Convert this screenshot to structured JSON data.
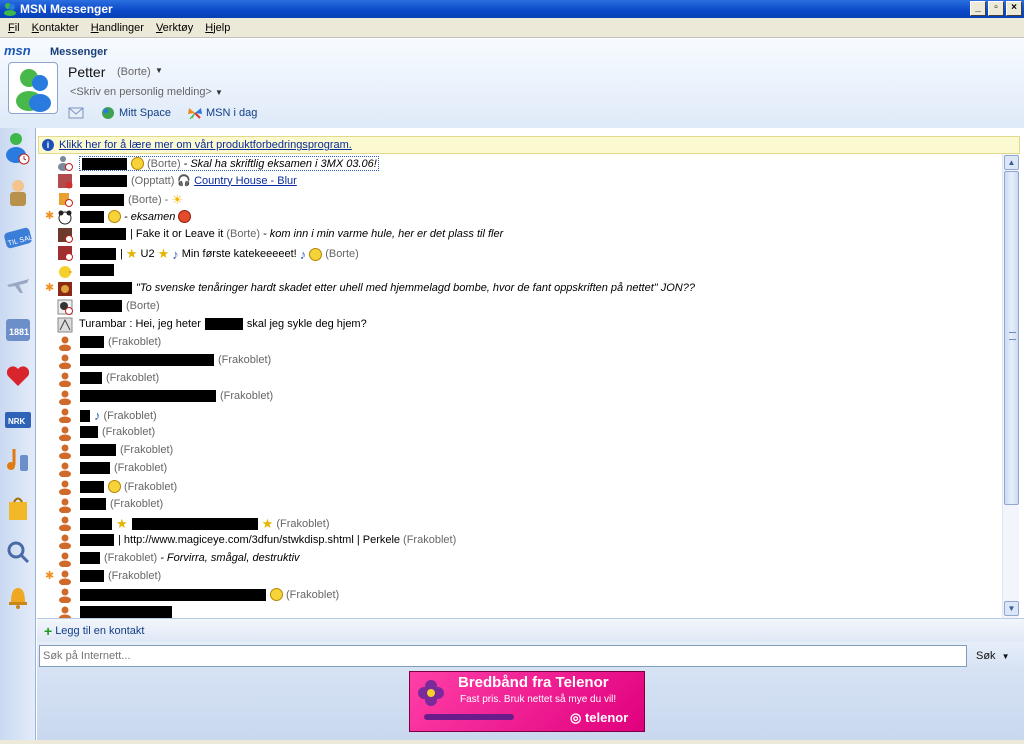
{
  "window": {
    "title": "MSN Messenger"
  },
  "menu": [
    {
      "label": "Fil",
      "u": "F",
      "rest": "il"
    },
    {
      "label": "Kontakter",
      "u": "K",
      "rest": "ontakter"
    },
    {
      "label": "Handlinger",
      "u": "H",
      "rest": "andlinger"
    },
    {
      "label": "Verktøy",
      "u": "V",
      "rest": "erktøy"
    },
    {
      "label": "Hjelp",
      "u": "H",
      "rest": "jelp"
    }
  ],
  "header": {
    "logo": "msn",
    "brand": "Messenger",
    "user_name": "Petter",
    "user_status": "(Borte)",
    "personal_message": "<Skriv en personlig melding>",
    "links": {
      "space": "Mitt Space",
      "today": "MSN i dag"
    }
  },
  "infobar": {
    "text": "Klikk her for å lære mer om vårt produktforbedringsprogram."
  },
  "contacts": [
    {
      "text": "(Borte)",
      "extra": "- Skal ha skriftlig eksamen i 3MX 03.06!"
    },
    {
      "text": "(Opptatt)",
      "extra": "Country House - Blur"
    },
    {
      "text": "(Borte) -"
    },
    {
      "text": "- eksamen"
    },
    {
      "text": "| Fake it or Leave it",
      "status": "(Borte)",
      "extra": "- kom inn i min varme hule, her er det plass til fler"
    },
    {
      "text": "U2",
      "extra": "Min første katekeeeeet!",
      "status": "(Borte)"
    },
    {
      "text": ""
    },
    {
      "text": "\"To svenske tenåringer hardt skadet etter uhell med hjemmelagd bombe, hvor de fant oppskriften på nettet\" JON??"
    },
    {
      "text": "(Borte)"
    },
    {
      "text": "Turambar : Hei, jeg heter",
      "extra": "skal jeg sykle deg hjem?"
    },
    {
      "text": "(Frakoblet)"
    },
    {
      "text": "(Frakoblet)"
    },
    {
      "text": "(Frakoblet)"
    },
    {
      "text": "(Frakoblet)"
    },
    {
      "text": "(Frakoblet)"
    },
    {
      "text": "(Frakoblet)"
    },
    {
      "text": "(Frakoblet)"
    },
    {
      "text": "(Frakoblet)"
    },
    {
      "text": "(Frakoblet)"
    },
    {
      "text": "(Frakoblet)"
    },
    {
      "text": "(Frakoblet)"
    },
    {
      "text": "| http://www.magiceye.com/3dfun/stwkdisp.shtml | Perkele",
      "status": "(Frakoblet)"
    },
    {
      "text": "(Frakoblet)",
      "extra": "- Forvirra, smågal, destruktiv"
    },
    {
      "text": "(Frakoblet)"
    },
    {
      "text": "(Frakoblet)"
    },
    {
      "text": ""
    }
  ],
  "add_contact": {
    "label": "Legg til en kontakt"
  },
  "search": {
    "placeholder": "Søk på Internett...",
    "button": "Søk"
  },
  "ad": {
    "title": "Bredbånd fra Telenor",
    "subtitle": "Fast pris. Bruk nettet så mye du vil!",
    "brand": "telenor"
  },
  "tabs": [
    {
      "name": "til-salgs-tab",
      "label": "TIL SALGS"
    },
    {
      "name": "opplysningen-tab",
      "label": "1881"
    },
    {
      "name": "nrk-tab",
      "label": "NRK"
    }
  ],
  "colors": {
    "accent": "#1b57b8",
    "info_bg": "#fbf9d0",
    "ad_pink": "#e0007d"
  }
}
